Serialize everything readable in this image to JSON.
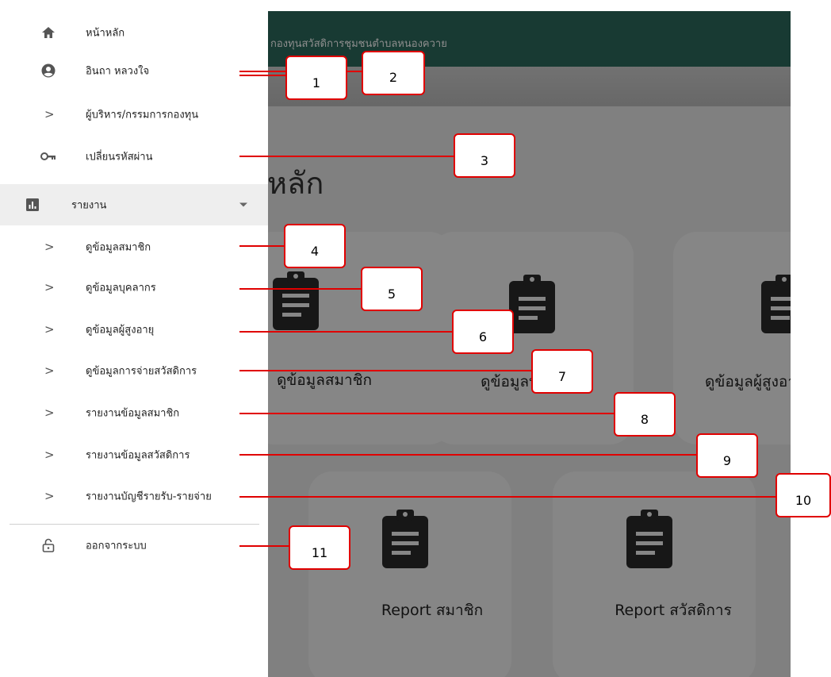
{
  "background_app": {
    "topbar_title": "กองทุนสวัสดิการชุมชนตำบลหนองควาย",
    "page_title": "หลัก",
    "cards": [
      {
        "label": "ดูข้อมูลสมาชิก",
        "icon": "clipboard-icon"
      },
      {
        "label": "ดูข้อมูลบุคลากร",
        "icon": "clipboard-icon"
      },
      {
        "label": "ดูข้อมูลผู้สูงอายุ",
        "icon": "clipboard-icon"
      },
      {
        "label": "Report สมาชิก",
        "icon": "clipboard-icon"
      },
      {
        "label": "Report สวัสดิการ",
        "icon": "clipboard-icon"
      }
    ]
  },
  "drawer": {
    "items": [
      {
        "label": "หน้าหลัก",
        "icon": "home-icon"
      },
      {
        "label": "อินถา หลวงใจ",
        "icon": "account-circle-icon"
      },
      {
        "label": "ผู้บริหาร/กรรมการกองทุน",
        "icon": "chevron-right-icon"
      },
      {
        "label": "เปลี่ยนรหัสผ่าน",
        "icon": "key-icon"
      }
    ],
    "section": {
      "label": "รายงาน",
      "icon": "bar-chart-icon"
    },
    "report_items": [
      {
        "label": "ดูข้อมูลสมาชิก"
      },
      {
        "label": "ดูข้อมูลบุคลากร"
      },
      {
        "label": "ดูข้อมูลผู้สูงอายุ"
      },
      {
        "label": "ดูข้อมูลการจ่ายสวัสดิการ"
      },
      {
        "label": "รายงานข้อมูลสมาชิก"
      },
      {
        "label": "รายงานข้อมูลสวัสดิการ"
      },
      {
        "label": "รายงานบัญชีรายรับ-รายจ่าย"
      }
    ],
    "logout": {
      "label": "ออกจากระบบ",
      "icon": "lock-open-icon"
    },
    "chevron_glyph": ">"
  },
  "annotations": [
    "1",
    "2",
    "3",
    "4",
    "5",
    "6",
    "7",
    "8",
    "9",
    "10",
    "11"
  ],
  "colors": {
    "topbar": "#2d6b5e",
    "annotation": "#e00000"
  }
}
